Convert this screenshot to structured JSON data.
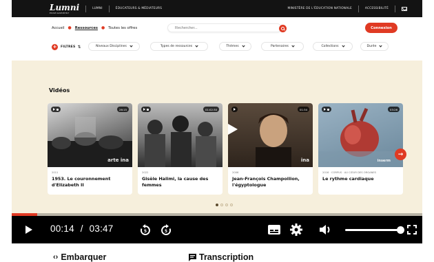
{
  "topbar": {
    "logo": "Lumni",
    "logo_sub": "ENSEIGNEMENT",
    "links": [
      "LUMNI",
      "ÉDUCATEURS & MÉDIATEURS"
    ],
    "ministry": "MINISTÈRE DE L'ÉDUCATION NATIONALE",
    "accessibility": "ACCESSIBILITÉ"
  },
  "breadcrumb": [
    "Accueil",
    "Ressources",
    "Toutes les offres"
  ],
  "search": {
    "placeholder": "Rechercher..."
  },
  "connexion_label": "Connexion",
  "filters": {
    "label": "FILTRES",
    "options": [
      "Niveaux Disciplines",
      "Types de ressources",
      "Thèmes",
      "Partenaires",
      "Collections",
      "Durée"
    ]
  },
  "section_title": "Vidéos",
  "cards": [
    {
      "meta": "2011",
      "title": "1953. Le couronnement d'Elizabeth II",
      "duration": "26:15",
      "watermark": "arte ina"
    },
    {
      "meta": "2022",
      "title": "Gisèle Halimi, la cause des femmes",
      "duration": "01:02:30",
      "watermark": ""
    },
    {
      "meta": "2006",
      "title": "Jean-François Champollion, l'égyptologue",
      "duration": "01:34",
      "watermark": "ina"
    },
    {
      "meta": "2016 · CORPUS · AU CŒUR DES ORGANES",
      "title": "Le rythme cardiaque",
      "duration": "03:26",
      "watermark": "inserm"
    }
  ],
  "player": {
    "current_time": "00:14",
    "separator": "/",
    "total_time": "03:47",
    "progress": 0.062,
    "volume": 0.95
  },
  "bottom": {
    "embed_label": "Embarquer",
    "transcript_label": "Transcription"
  },
  "colors": {
    "accent": "#e03a23",
    "page_bg": "#f6efdc",
    "topbar": "#131313"
  }
}
